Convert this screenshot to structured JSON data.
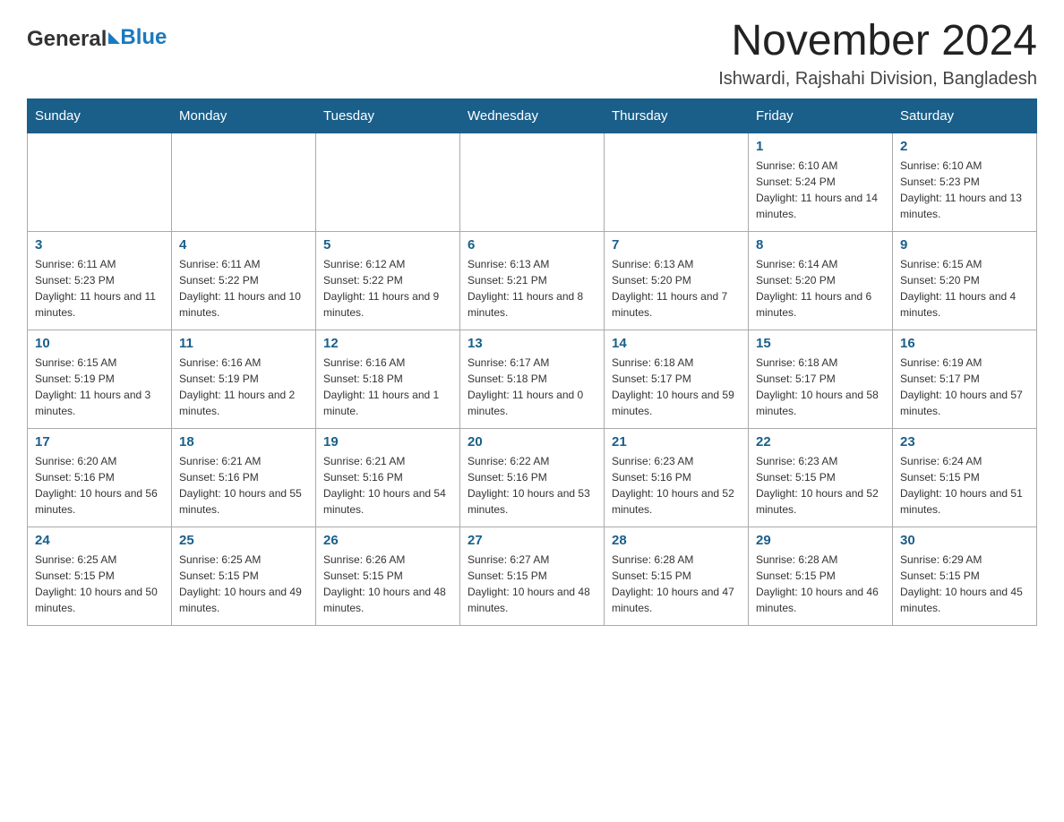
{
  "logo": {
    "general": "General",
    "blue": "Blue"
  },
  "header": {
    "title": "November 2024",
    "subtitle": "Ishwardi, Rajshahi Division, Bangladesh"
  },
  "days_of_week": [
    "Sunday",
    "Monday",
    "Tuesday",
    "Wednesday",
    "Thursday",
    "Friday",
    "Saturday"
  ],
  "weeks": [
    [
      {
        "day": "",
        "info": ""
      },
      {
        "day": "",
        "info": ""
      },
      {
        "day": "",
        "info": ""
      },
      {
        "day": "",
        "info": ""
      },
      {
        "day": "",
        "info": ""
      },
      {
        "day": "1",
        "info": "Sunrise: 6:10 AM\nSunset: 5:24 PM\nDaylight: 11 hours and 14 minutes."
      },
      {
        "day": "2",
        "info": "Sunrise: 6:10 AM\nSunset: 5:23 PM\nDaylight: 11 hours and 13 minutes."
      }
    ],
    [
      {
        "day": "3",
        "info": "Sunrise: 6:11 AM\nSunset: 5:23 PM\nDaylight: 11 hours and 11 minutes."
      },
      {
        "day": "4",
        "info": "Sunrise: 6:11 AM\nSunset: 5:22 PM\nDaylight: 11 hours and 10 minutes."
      },
      {
        "day": "5",
        "info": "Sunrise: 6:12 AM\nSunset: 5:22 PM\nDaylight: 11 hours and 9 minutes."
      },
      {
        "day": "6",
        "info": "Sunrise: 6:13 AM\nSunset: 5:21 PM\nDaylight: 11 hours and 8 minutes."
      },
      {
        "day": "7",
        "info": "Sunrise: 6:13 AM\nSunset: 5:20 PM\nDaylight: 11 hours and 7 minutes."
      },
      {
        "day": "8",
        "info": "Sunrise: 6:14 AM\nSunset: 5:20 PM\nDaylight: 11 hours and 6 minutes."
      },
      {
        "day": "9",
        "info": "Sunrise: 6:15 AM\nSunset: 5:20 PM\nDaylight: 11 hours and 4 minutes."
      }
    ],
    [
      {
        "day": "10",
        "info": "Sunrise: 6:15 AM\nSunset: 5:19 PM\nDaylight: 11 hours and 3 minutes."
      },
      {
        "day": "11",
        "info": "Sunrise: 6:16 AM\nSunset: 5:19 PM\nDaylight: 11 hours and 2 minutes."
      },
      {
        "day": "12",
        "info": "Sunrise: 6:16 AM\nSunset: 5:18 PM\nDaylight: 11 hours and 1 minute."
      },
      {
        "day": "13",
        "info": "Sunrise: 6:17 AM\nSunset: 5:18 PM\nDaylight: 11 hours and 0 minutes."
      },
      {
        "day": "14",
        "info": "Sunrise: 6:18 AM\nSunset: 5:17 PM\nDaylight: 10 hours and 59 minutes."
      },
      {
        "day": "15",
        "info": "Sunrise: 6:18 AM\nSunset: 5:17 PM\nDaylight: 10 hours and 58 minutes."
      },
      {
        "day": "16",
        "info": "Sunrise: 6:19 AM\nSunset: 5:17 PM\nDaylight: 10 hours and 57 minutes."
      }
    ],
    [
      {
        "day": "17",
        "info": "Sunrise: 6:20 AM\nSunset: 5:16 PM\nDaylight: 10 hours and 56 minutes."
      },
      {
        "day": "18",
        "info": "Sunrise: 6:21 AM\nSunset: 5:16 PM\nDaylight: 10 hours and 55 minutes."
      },
      {
        "day": "19",
        "info": "Sunrise: 6:21 AM\nSunset: 5:16 PM\nDaylight: 10 hours and 54 minutes."
      },
      {
        "day": "20",
        "info": "Sunrise: 6:22 AM\nSunset: 5:16 PM\nDaylight: 10 hours and 53 minutes."
      },
      {
        "day": "21",
        "info": "Sunrise: 6:23 AM\nSunset: 5:16 PM\nDaylight: 10 hours and 52 minutes."
      },
      {
        "day": "22",
        "info": "Sunrise: 6:23 AM\nSunset: 5:15 PM\nDaylight: 10 hours and 52 minutes."
      },
      {
        "day": "23",
        "info": "Sunrise: 6:24 AM\nSunset: 5:15 PM\nDaylight: 10 hours and 51 minutes."
      }
    ],
    [
      {
        "day": "24",
        "info": "Sunrise: 6:25 AM\nSunset: 5:15 PM\nDaylight: 10 hours and 50 minutes."
      },
      {
        "day": "25",
        "info": "Sunrise: 6:25 AM\nSunset: 5:15 PM\nDaylight: 10 hours and 49 minutes."
      },
      {
        "day": "26",
        "info": "Sunrise: 6:26 AM\nSunset: 5:15 PM\nDaylight: 10 hours and 48 minutes."
      },
      {
        "day": "27",
        "info": "Sunrise: 6:27 AM\nSunset: 5:15 PM\nDaylight: 10 hours and 48 minutes."
      },
      {
        "day": "28",
        "info": "Sunrise: 6:28 AM\nSunset: 5:15 PM\nDaylight: 10 hours and 47 minutes."
      },
      {
        "day": "29",
        "info": "Sunrise: 6:28 AM\nSunset: 5:15 PM\nDaylight: 10 hours and 46 minutes."
      },
      {
        "day": "30",
        "info": "Sunrise: 6:29 AM\nSunset: 5:15 PM\nDaylight: 10 hours and 45 minutes."
      }
    ]
  ]
}
